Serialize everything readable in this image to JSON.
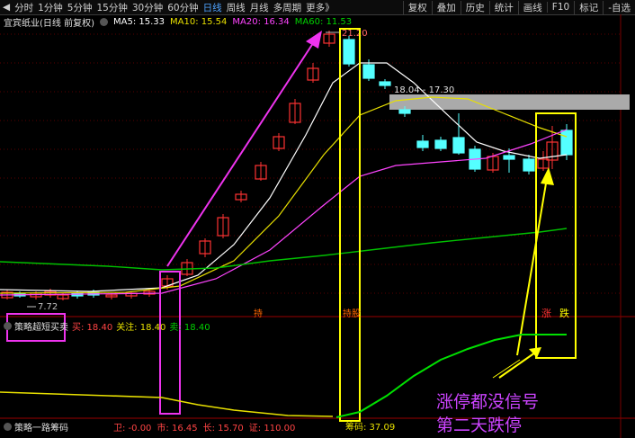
{
  "toolbar": {
    "periods": [
      "分时",
      "1分钟",
      "5分钟",
      "15分钟",
      "30分钟",
      "60分钟",
      "日线",
      "周线",
      "月线",
      "多周期",
      "更多》"
    ],
    "active_period": "日线",
    "actions": [
      "复权",
      "叠加",
      "历史",
      "统计",
      "画线",
      "F10",
      "标记",
      "-自选"
    ]
  },
  "ma_header": {
    "stock": "宜宾纸业(日线 前复权)",
    "ma5": "MA5: 15.33",
    "ma10": "MA10: 15.54",
    "ma20": "MA20: 16.34",
    "ma60": "MA60: 11.53"
  },
  "price_labels": {
    "high": "21.20",
    "low": "7.72",
    "range": "18.04 - 17.30"
  },
  "indicator1": {
    "name": "策略超短买卖",
    "buy": "买: 18.40",
    "watch": "关注: 18.40",
    "sell": "卖: 18.40"
  },
  "signals": {
    "sig1": "持",
    "sig2": "持股",
    "zhang": "涨",
    "die": "跌"
  },
  "indicator2": {
    "name": "策略一路筹码",
    "fragment": "筹码: 37.09",
    "v1": "卫: -0.00",
    "v2": "市: 16.45",
    "v3": "长: 15.70",
    "v4": "证: 110.00"
  },
  "annotation": {
    "line1": "涨停都没信号",
    "line2": "第二天跌停"
  },
  "colors": {
    "up": "#ff3333",
    "down": "#54ffff",
    "ma5": "#ffffff",
    "ma10": "#e8e000",
    "ma20": "#ff44ff",
    "ma60": "#00c000",
    "box_yellow": "#ffff00",
    "box_magenta": "#ee33ee"
  }
}
